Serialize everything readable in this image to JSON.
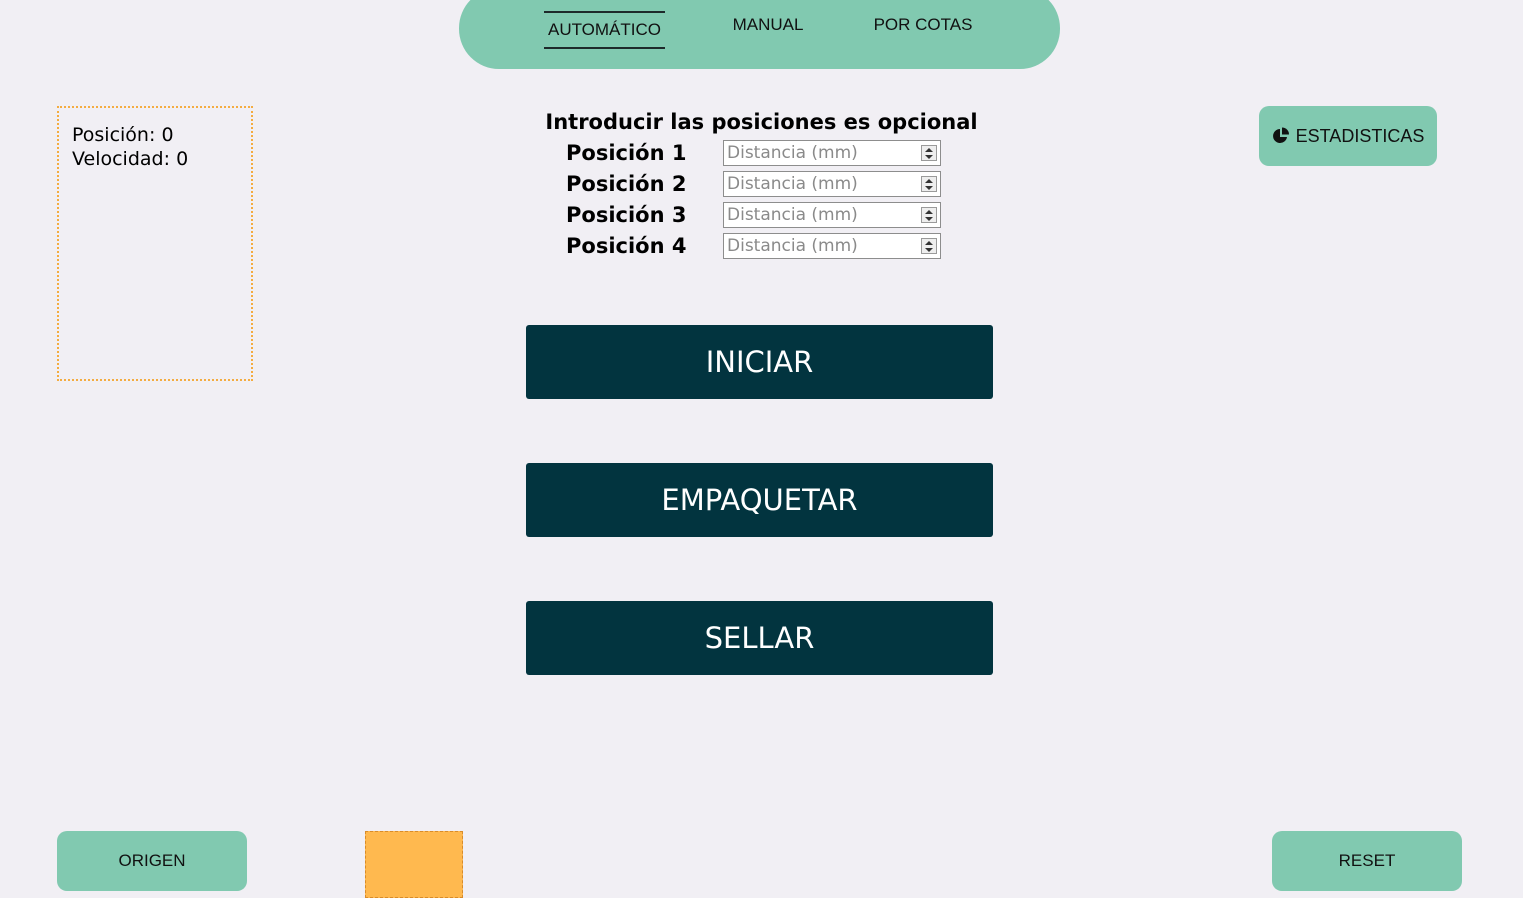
{
  "nav": {
    "tabs": [
      {
        "label": "AUTOMÁTICO",
        "active": true
      },
      {
        "label": "MANUAL",
        "active": false
      },
      {
        "label": "POR COTAS",
        "active": false
      }
    ]
  },
  "status": {
    "position_label": "Posición:",
    "position_value": "0",
    "velocity_label": "Velocidad:",
    "velocity_value": "0"
  },
  "stats_button": {
    "label": "ESTADISTICAS",
    "icon": "pie-chart-icon"
  },
  "positions": {
    "hint": "Introducir las posiciones es opcional",
    "rows": [
      {
        "label": "Posición 1",
        "placeholder": "Distancia (mm)",
        "value": ""
      },
      {
        "label": "Posición 2",
        "placeholder": "Distancia (mm)",
        "value": ""
      },
      {
        "label": "Posición 3",
        "placeholder": "Distancia (mm)",
        "value": ""
      },
      {
        "label": "Posición 4",
        "placeholder": "Distancia (mm)",
        "value": ""
      }
    ]
  },
  "actions": {
    "start": "INICIAR",
    "pack": "EMPAQUETAR",
    "seal": "SELLAR"
  },
  "footer": {
    "origin": "ORIGEN",
    "reset": "RESET"
  },
  "colors": {
    "accent": "#81c9b0",
    "primary_button": "#02343f",
    "indicator": "#ffb94f",
    "background": "#f1eff4"
  }
}
